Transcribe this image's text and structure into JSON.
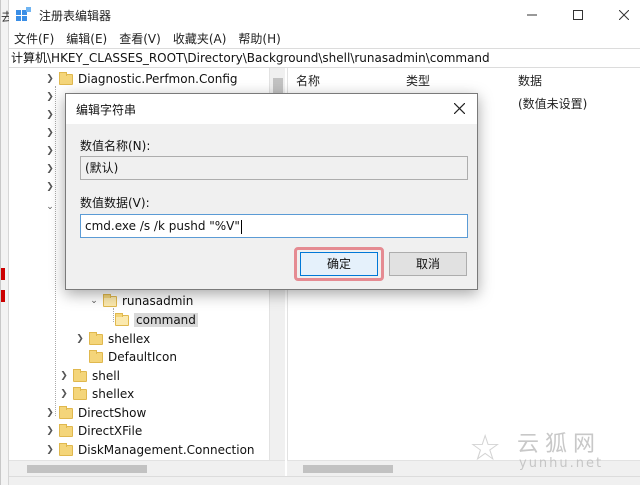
{
  "window": {
    "title": "注册表编辑器",
    "left_strip_glyph": "去"
  },
  "menubar": {
    "items": [
      "文件(F)",
      "编辑(E)",
      "查看(V)",
      "收藏夹(A)",
      "帮助(H)"
    ]
  },
  "address": {
    "path": "计算机\\HKEY_CLASSES_ROOT\\Directory\\Background\\shell\\runasadmin\\command"
  },
  "tree": {
    "items": [
      {
        "label": "Diagnostic.Perfmon.Config"
      },
      {
        "label": "runasadmin"
      },
      {
        "label": "command"
      },
      {
        "label": "shellex"
      },
      {
        "label": "DefaultIcon"
      },
      {
        "label": "shell"
      },
      {
        "label": "shellex"
      },
      {
        "label": "DirectShow"
      },
      {
        "label": "DirectXFile"
      },
      {
        "label": "DiskManagement.Connection"
      }
    ]
  },
  "values_pane": {
    "columns": [
      "名称",
      "类型",
      "数据"
    ],
    "rows": [
      {
        "data": "(数值未设置)"
      }
    ]
  },
  "dialog": {
    "title": "编辑字符串",
    "name_label": "数值名称(N):",
    "name_value": "(默认)",
    "data_label": "数值数据(V):",
    "data_value": "cmd.exe /s /k pushd \"%V\"",
    "ok_label": "确定",
    "cancel_label": "取消",
    "highlight_color": "#e58b92"
  },
  "watermark": {
    "main": "云狐网",
    "sub": "yunhu.net"
  }
}
